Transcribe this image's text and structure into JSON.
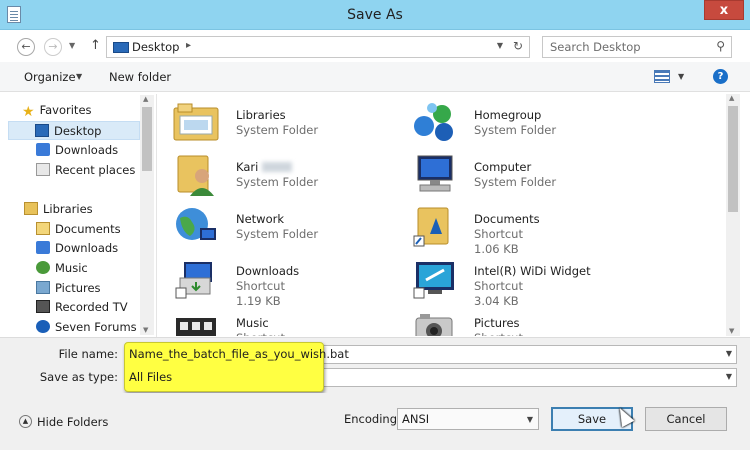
{
  "window": {
    "title": "Save As",
    "close_label": "x"
  },
  "address": {
    "back": "←",
    "forward": "→",
    "up": "↑",
    "location": "Desktop",
    "separator": "▸",
    "refresh": "↻",
    "search_placeholder": "Search Desktop",
    "search_icon": "magnifier-icon"
  },
  "toolbar": {
    "organize": "Organize",
    "new_folder": "New folder",
    "help": "?"
  },
  "nav": [
    {
      "label": "Favorites",
      "icon": "star-icon"
    },
    {
      "label": "Desktop",
      "icon": "desktop-icon",
      "selected": true
    },
    {
      "label": "Downloads",
      "icon": "downloads-icon"
    },
    {
      "label": "Recent places",
      "icon": "recent-places-icon"
    },
    {
      "label": "Libraries",
      "icon": "libraries-icon"
    },
    {
      "label": "Documents",
      "icon": "documents-icon"
    },
    {
      "label": "Downloads",
      "icon": "downloads-icon"
    },
    {
      "label": "Music",
      "icon": "music-icon"
    },
    {
      "label": "Pictures",
      "icon": "pictures-icon"
    },
    {
      "label": "Recorded TV",
      "icon": "recorded-tv-icon"
    },
    {
      "label": "Seven Forums",
      "icon": "info-icon"
    }
  ],
  "items": [
    {
      "name": "Libraries",
      "type": "System Folder",
      "size": ""
    },
    {
      "name": "Homegroup",
      "type": "System Folder",
      "size": ""
    },
    {
      "name": "Kari",
      "type": "System Folder",
      "size": ""
    },
    {
      "name": "Computer",
      "type": "System Folder",
      "size": ""
    },
    {
      "name": "Network",
      "type": "System Folder",
      "size": ""
    },
    {
      "name": "Documents",
      "type": "Shortcut",
      "size": "1.06 KB"
    },
    {
      "name": "Downloads",
      "type": "Shortcut",
      "size": "1.19 KB"
    },
    {
      "name": "Intel(R) WiDi Widget",
      "type": "Shortcut",
      "size": "3.04 KB"
    },
    {
      "name": "Music",
      "type": "Shortcut",
      "size": ""
    },
    {
      "name": "Pictures",
      "type": "Shortcut",
      "size": ""
    }
  ],
  "form": {
    "file_name_label": "File name:",
    "file_name_value": "Name_the_batch_file_as_you_wish.bat",
    "save_as_type_label": "Save as type:",
    "save_as_type_value": "All Files"
  },
  "footer": {
    "hide_folders": "Hide Folders",
    "encoding_label": "Encoding:",
    "encoding_value": "ANSI",
    "save": "Save",
    "cancel": "Cancel"
  }
}
